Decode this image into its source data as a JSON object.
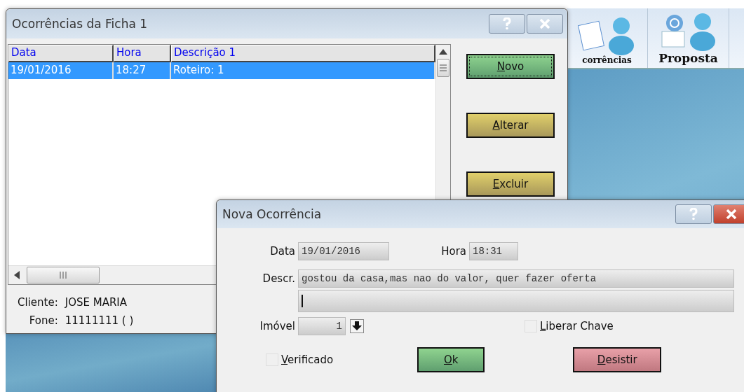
{
  "main_window": {
    "title": "Ocorrências da Ficha 1",
    "columns": [
      "Data",
      "Hora",
      "Descrição 1"
    ],
    "rows": [
      {
        "cells": [
          "19/01/2016",
          "18:27",
          "Roteiro: 1"
        ],
        "selected": true
      }
    ],
    "buttons": [
      {
        "label": "Novo",
        "kind": "green",
        "focused": true
      },
      {
        "label": "Alterar",
        "kind": "olive",
        "focused": false
      },
      {
        "label": "Excluir",
        "kind": "olive",
        "focused": false
      }
    ],
    "info": [
      {
        "label": "Cliente:",
        "value": "JOSE MARIA"
      },
      {
        "label": "Fone:",
        "value": "11111111 ( )"
      }
    ]
  },
  "toolbar": [
    {
      "label": "corrências",
      "kind": "doc"
    },
    {
      "label": "Proposta",
      "kind": "money"
    }
  ],
  "dialog": {
    "title": "Nova Ocorrência",
    "date": {
      "label": "Data",
      "value": "19/01/2016"
    },
    "time": {
      "label": "Hora",
      "value": "18:31"
    },
    "description": {
      "label": "Descr.",
      "value": "gostou da casa,mas nao do valor, quer fazer oferta"
    },
    "property": {
      "label": "Imóvel",
      "value": "1"
    },
    "checkboxes": [
      {
        "label": "Liberar Chave",
        "checked": false
      },
      {
        "label": "Verificado",
        "checked": false
      }
    ],
    "buttons": [
      {
        "label": "Ok",
        "kind": "ok"
      },
      {
        "label": "Desistir",
        "kind": "cancel"
      }
    ]
  }
}
